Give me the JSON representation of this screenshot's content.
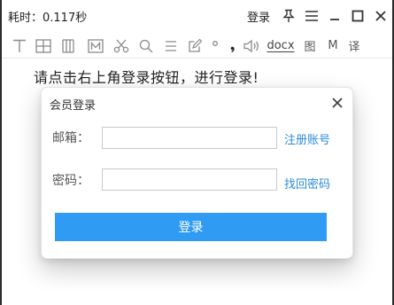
{
  "titlebar": {
    "timing": "耗时：0.117秒",
    "login_label": "登录"
  },
  "toolbar": {
    "docx_label": "docx",
    "image_label": "图",
    "m_label": "M",
    "translate_label": "译"
  },
  "instruction": "请点击右上角登录按钮，进行登录!",
  "dialog": {
    "title": "会员登录",
    "email_label": "邮箱：",
    "email_value": "",
    "register_link": "注册账号",
    "password_label": "密码：",
    "password_value": "",
    "recover_link": "找回密码",
    "submit_label": "登录"
  },
  "colors": {
    "accent": "#2f9bf2",
    "link": "#2d8bd6",
    "icon_gray": "#8a8a8a"
  }
}
